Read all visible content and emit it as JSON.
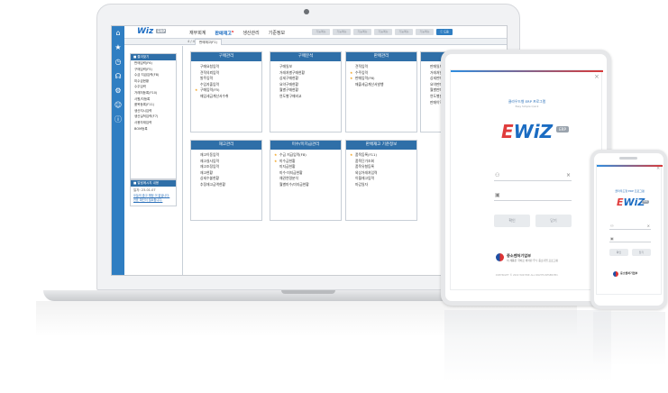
{
  "laptop": {
    "nav_icons": [
      "home-icon",
      "star-icon",
      "clock-icon",
      "headset-icon",
      "gear-icon",
      "users-icon",
      "info-icon"
    ],
    "nav_glyphs": [
      "⌂",
      "★",
      "◷",
      "☊",
      "⚙",
      "☺",
      "ⓘ"
    ],
    "logo": {
      "text": "Wiz",
      "tag": "ERP"
    },
    "menu": [
      {
        "label": "재무회계",
        "active": false
      },
      {
        "label": "판매재고",
        "active": true,
        "badge": "N"
      },
      {
        "label": "생산관리",
        "active": false
      },
      {
        "label": "기준정보",
        "active": false
      }
    ],
    "top_buttons": [
      "기능메뉴",
      "기능메뉴",
      "기능메뉴",
      "기능메뉴",
      "기능메뉴",
      "기능메뉴"
    ],
    "help_button": "ⓘ 도움",
    "pager": "4 / 4",
    "active_tab": "판매재고(F1)",
    "favorites": {
      "title": "■ 즐겨찾기",
      "items": [
        "판매입력(F6)",
        "구매입력(F5)",
        "수금 지급입력(F8)",
        "미수금현황",
        "수주입력",
        "거래처등록(F10)",
        "사원/자등록",
        "품목등록(F11)",
        "생산지시입력",
        "생산실적입력(F7)",
        "사용자재입력",
        "BOM등록"
      ]
    },
    "memo": {
      "title": "■ 알림메시지 내용",
      "time": "일자: 23-01-07",
      "text": "오늘의 출고 예정 이 없습니다. 전표 확인이 필요합니다."
    },
    "cards": [
      {
        "title": "구매관리",
        "items": [
          [
            "구매요청입력",
            false
          ],
          [
            "견적의뢰입력",
            false
          ],
          [
            "발주입력",
            false
          ],
          [
            "수입지출입력",
            false
          ],
          [
            "구매입력(F5)",
            true
          ],
          [
            "매입세금계산서수취",
            false
          ]
        ]
      },
      {
        "title": "구매분석",
        "items": [
          [
            "구매일보",
            false
          ],
          [
            "거래처별구매현황",
            false
          ],
          [
            "상세구매현황",
            false
          ],
          [
            "요약구매현황",
            false
          ],
          [
            "월별구매현황",
            false
          ],
          [
            "연도별구매비교",
            false
          ]
        ]
      },
      {
        "title": "판매관리",
        "items": [
          [
            "견적입력",
            false
          ],
          [
            "수주입력",
            true
          ],
          [
            "판매입력(F6)",
            true
          ],
          [
            "매출세금계산서발행",
            false
          ]
        ]
      },
      {
        "title": "판매분석",
        "items": [
          [
            "판매일보",
            false
          ],
          [
            "거래처별판매현황",
            false
          ],
          [
            "상세판매현황",
            false
          ],
          [
            "요약판매현황",
            false
          ],
          [
            "월별판매현황",
            false
          ],
          [
            "연도별판매비교",
            false
          ],
          [
            "판매이익현황",
            false
          ]
        ]
      },
      {
        "title": "재고관리",
        "items": [
          [
            "재고이동입력",
            false
          ],
          [
            "재고실사입력",
            false
          ],
          [
            "재고조정입력",
            false
          ],
          [
            "재고현황",
            false
          ],
          [
            "상세수불현황",
            false
          ],
          [
            "추정재고금액현황",
            false
          ]
        ]
      },
      {
        "title": "미수/미지급관리",
        "items": [
          [
            "수금 지급입력(F8)",
            true
          ],
          [
            "미수금현황",
            true
          ],
          [
            "미지급현황",
            false
          ],
          [
            "미수·미지급현황",
            false
          ],
          [
            "채권연령분석",
            false
          ],
          [
            "월별미수/미지급현황",
            false
          ]
        ]
      },
      {
        "title": "판매재고 기준정보",
        "items": [
          [
            "품목등록(F11)",
            true
          ],
          [
            "품목단가조회",
            false
          ],
          [
            "품목유형등록",
            false
          ],
          [
            "외상거래처입력",
            false
          ],
          [
            "이월재고입력",
            false
          ],
          [
            "마감일자",
            false
          ]
        ]
      }
    ]
  },
  "tablet": {
    "tagline": "클라우드형 ERP 프로그램",
    "tagline_sub": "Easy Simple Quick",
    "logo": {
      "w": "E",
      "text": "WiZ",
      "tag": "ERP"
    },
    "id_placeholder": "",
    "pw_placeholder": "",
    "btn_left": "확인",
    "btn_right": "닫기",
    "org": "중소벤처기업부",
    "org_sub": "이 제품은 국비로 제작된 우수 중소기업 프로그램",
    "copyright": "COPYRIGHT © 2022 WIZ ERP. ALL RIGHTS RESERVED."
  },
  "phone": {
    "tagline": "클라우드형 ERP 프로그램",
    "logo": {
      "w": "E",
      "text": "WiZ",
      "tag": "ERP"
    },
    "btn_left": "확인",
    "btn_right": "닫기",
    "org": "중소벤처기업부"
  }
}
